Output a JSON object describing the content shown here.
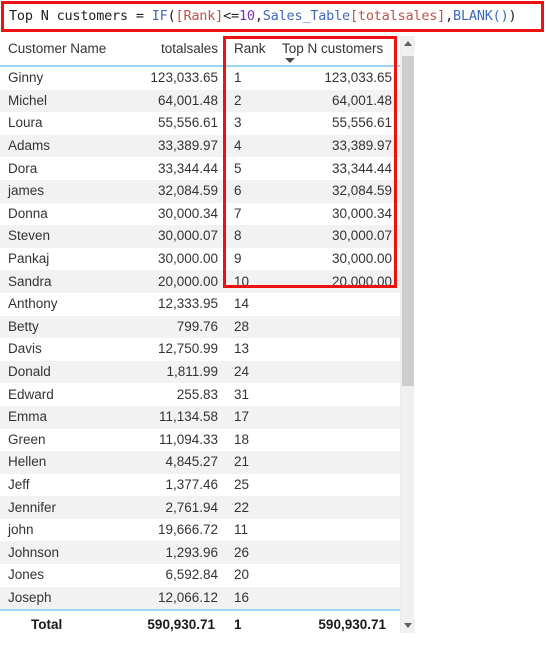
{
  "formula": {
    "measure_name": "Top N customers",
    "equals": " = ",
    "function": "IF",
    "open_paren": "(",
    "rank_column": "[Rank]",
    "operator": "<=",
    "threshold": "10",
    "comma1": ",",
    "table_ref": "Sales_Table",
    "table_column": "[totalsales]",
    "comma2": ",",
    "blank_fn": "BLANK()",
    "close_paren": ")",
    "full_text": "Top N customers = IF([Rank]<=10,Sales_Table[totalsales],BLANK())",
    "highlight_color": "#ee1111"
  },
  "table": {
    "headers": {
      "customer_name": "Customer Name",
      "totalsales": "totalsales",
      "rank": "Rank",
      "topn": "Top N customers"
    },
    "sort_indicator": "sort-descending-caret",
    "rows": [
      {
        "name": "Ginny",
        "totalsales": "123,033.65",
        "rank": "1",
        "topn": "123,033.65"
      },
      {
        "name": "Michel",
        "totalsales": "64,001.48",
        "rank": "2",
        "topn": "64,001.48"
      },
      {
        "name": "Loura",
        "totalsales": "55,556.61",
        "rank": "3",
        "topn": "55,556.61"
      },
      {
        "name": "Adams",
        "totalsales": "33,389.97",
        "rank": "4",
        "topn": "33,389.97"
      },
      {
        "name": "Dora",
        "totalsales": "33,344.44",
        "rank": "5",
        "topn": "33,344.44"
      },
      {
        "name": "james",
        "totalsales": "32,084.59",
        "rank": "6",
        "topn": "32,084.59"
      },
      {
        "name": "Donna",
        "totalsales": "30,000.34",
        "rank": "7",
        "topn": "30,000.34"
      },
      {
        "name": "Steven",
        "totalsales": "30,000.07",
        "rank": "8",
        "topn": "30,000.07"
      },
      {
        "name": "Pankaj",
        "totalsales": "30,000.00",
        "rank": "9",
        "topn": "30,000.00"
      },
      {
        "name": "Sandra",
        "totalsales": "20,000.00",
        "rank": "10",
        "topn": "20,000.00"
      },
      {
        "name": "Anthony",
        "totalsales": "12,333.95",
        "rank": "14",
        "topn": ""
      },
      {
        "name": "Betty",
        "totalsales": "799.76",
        "rank": "28",
        "topn": ""
      },
      {
        "name": "Davis",
        "totalsales": "12,750.99",
        "rank": "13",
        "topn": ""
      },
      {
        "name": "Donald",
        "totalsales": "1,811.99",
        "rank": "24",
        "topn": ""
      },
      {
        "name": "Edward",
        "totalsales": "255.83",
        "rank": "31",
        "topn": ""
      },
      {
        "name": "Emma",
        "totalsales": "11,134.58",
        "rank": "17",
        "topn": ""
      },
      {
        "name": "Green",
        "totalsales": "11,094.33",
        "rank": "18",
        "topn": ""
      },
      {
        "name": "Hellen",
        "totalsales": "4,845.27",
        "rank": "21",
        "topn": ""
      },
      {
        "name": "Jeff",
        "totalsales": "1,377.46",
        "rank": "25",
        "topn": ""
      },
      {
        "name": "Jennifer",
        "totalsales": "2,761.94",
        "rank": "22",
        "topn": ""
      },
      {
        "name": "john",
        "totalsales": "19,666.72",
        "rank": "11",
        "topn": ""
      },
      {
        "name": "Johnson",
        "totalsales": "1,293.96",
        "rank": "26",
        "topn": ""
      },
      {
        "name": "Jones",
        "totalsales": "6,592.84",
        "rank": "20",
        "topn": ""
      },
      {
        "name": "Joseph",
        "totalsales": "12,066.12",
        "rank": "16",
        "topn": ""
      }
    ],
    "total": {
      "label": "Total",
      "totalsales": "590,930.71",
      "rank": "1",
      "topn": "590,930.71"
    }
  },
  "scrollbar": {
    "up_arrow": "chevron-up-icon",
    "down_arrow": "chevron-down-icon"
  },
  "annotation": {
    "formula_box": "red-highlight-rectangle",
    "columns_box": "red-highlight-rectangle"
  }
}
